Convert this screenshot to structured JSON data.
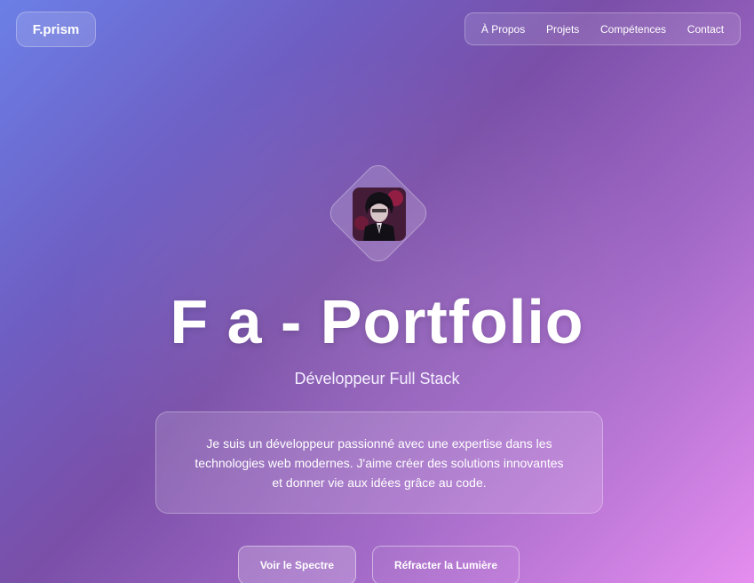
{
  "header": {
    "logo_text": "F.prism",
    "nav": [
      {
        "label": "À Propos"
      },
      {
        "label": "Projets"
      },
      {
        "label": "Compétences"
      },
      {
        "label": "Contact"
      }
    ]
  },
  "hero": {
    "avatar": "profile-avatar",
    "title": "F a - Portfolio",
    "subtitle": "Développeur Full Stack",
    "description": "Je suis un développeur passionné avec une expertise dans les technologies web modernes. J'aime créer des solutions innovantes et donner vie aux idées grâce au code.",
    "primary_button": "Voir le Spectre",
    "secondary_button": "Réfracter la Lumière"
  },
  "colors": {
    "gradient_start": "#6b7fe6",
    "gradient_mid": "#7a4fa8",
    "gradient_end": "#e58ef0"
  }
}
